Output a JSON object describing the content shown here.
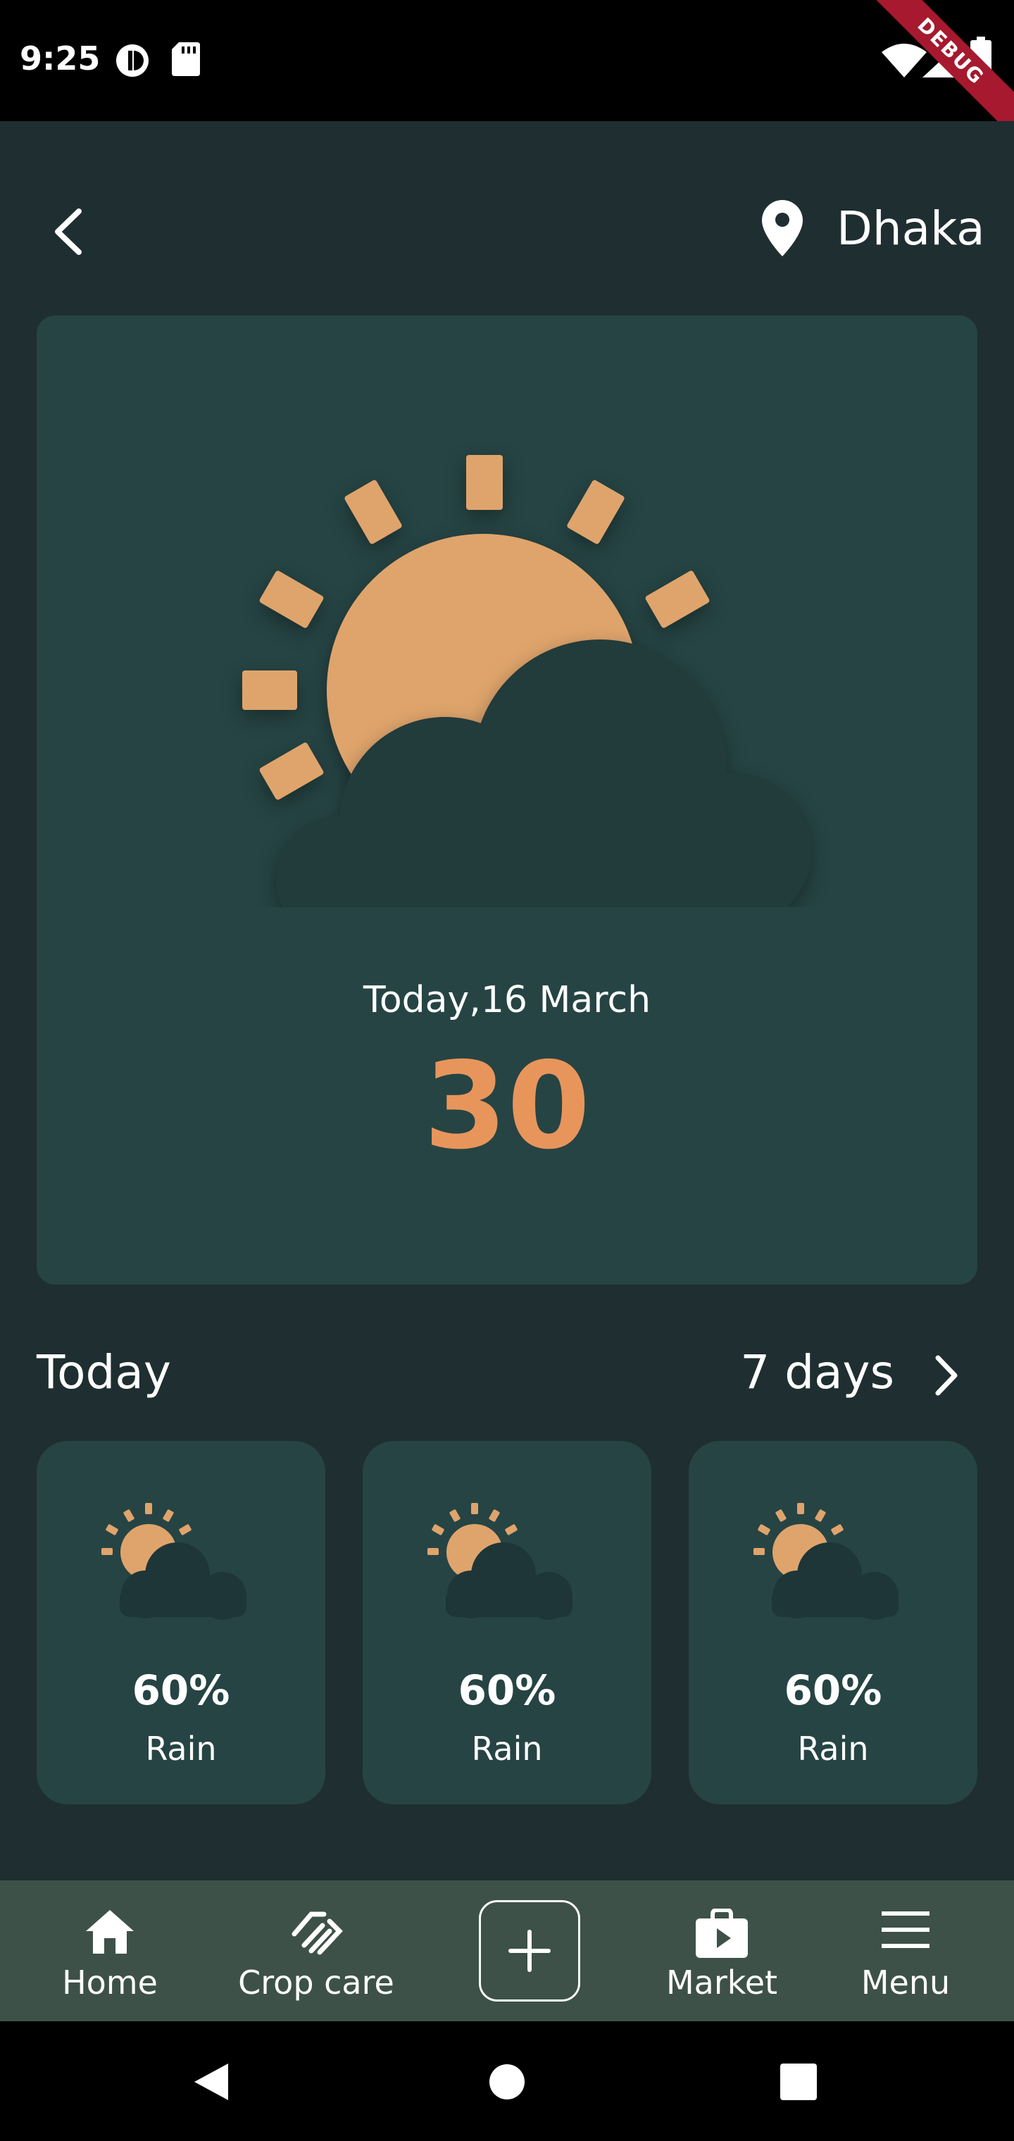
{
  "status_bar": {
    "time": "9:25",
    "debug_label": "DEBUG",
    "icons": [
      "focus-mode-icon",
      "sd-card-icon",
      "wifi-icon",
      "signal-icon",
      "battery-icon"
    ]
  },
  "header": {
    "back_icon": "chevron-left-icon",
    "location_icon": "location-pin-icon",
    "location": "Dhaka"
  },
  "hero": {
    "icon": "sun-behind-cloud-icon",
    "date": "Today,16 March",
    "temperature": "30"
  },
  "forecast": {
    "section_title": "Today",
    "more_label": "7 days",
    "more_icon": "chevron-right-icon",
    "cards": [
      {
        "percent": "60%",
        "label": "Rain",
        "icon": "sun-behind-cloud-icon"
      },
      {
        "percent": "60%",
        "label": "Rain",
        "icon": "sun-behind-cloud-icon"
      },
      {
        "percent": "60%",
        "label": "Rain",
        "icon": "sun-behind-cloud-icon"
      }
    ]
  },
  "bottom_nav": {
    "items": [
      {
        "label": "Home",
        "icon": "home-icon"
      },
      {
        "label": "Crop care",
        "icon": "handshake-icon"
      },
      {
        "label": "",
        "icon": "plus-icon"
      },
      {
        "label": "Market",
        "icon": "shopping-bag-icon"
      },
      {
        "label": "Menu",
        "icon": "hamburger-menu-icon"
      }
    ]
  },
  "system_nav": [
    "back-triangle-icon",
    "home-circle-icon",
    "recents-square-icon"
  ],
  "colors": {
    "background": "#1f2e31",
    "card": "#264444",
    "accent": "#e8955c",
    "sun": "#dfa46c",
    "nav_bar": "#3d5148"
  }
}
